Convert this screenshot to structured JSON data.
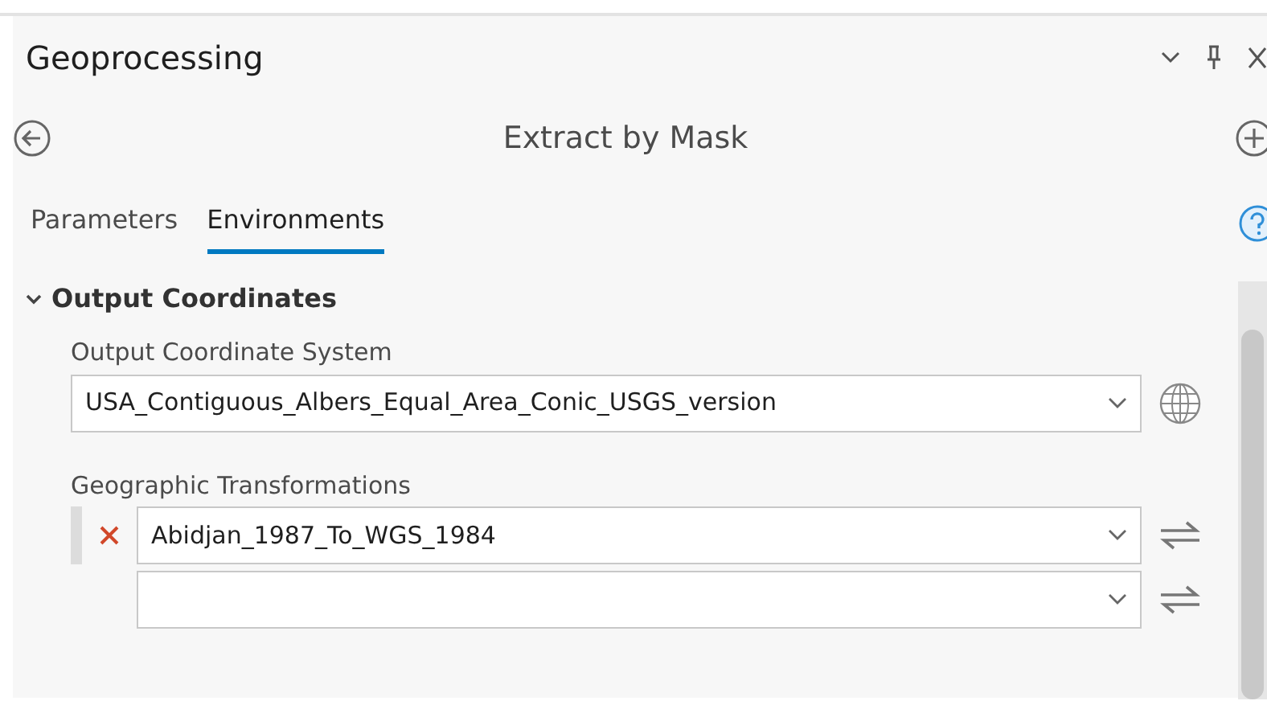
{
  "pane": {
    "title": "Geoprocessing"
  },
  "tool": {
    "title": "Extract by Mask"
  },
  "tabs": [
    {
      "label": "Parameters",
      "selected": false
    },
    {
      "label": "Environments",
      "selected": true
    }
  ],
  "section": {
    "title": "Output Coordinates",
    "expanded": true,
    "coordinate_system": {
      "label": "Output Coordinate System",
      "value": "USA_Contiguous_Albers_Equal_Area_Conic_USGS_version"
    },
    "transformations": {
      "label": "Geographic Transformations",
      "rows": [
        {
          "value": "Abidjan_1987_To_WGS_1984",
          "removable": true
        },
        {
          "value": "",
          "removable": false
        }
      ]
    }
  }
}
